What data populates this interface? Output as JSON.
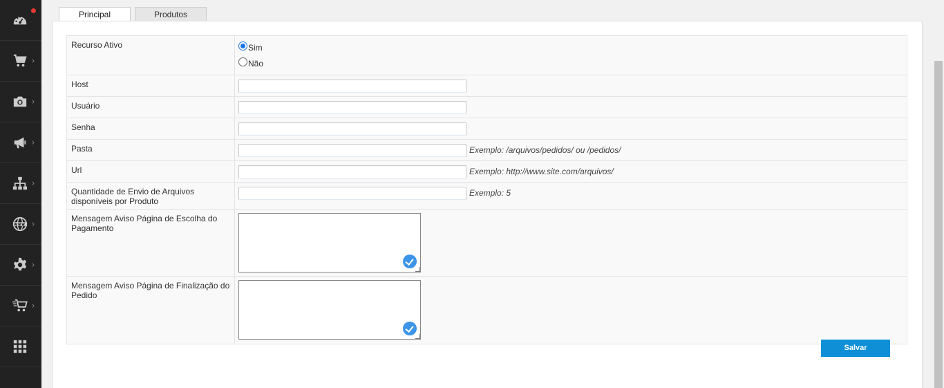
{
  "sidebar": {
    "items": [
      {
        "icon": "dashboard-icon",
        "has_chevron": false,
        "has_notification": true
      },
      {
        "icon": "cart-icon",
        "has_chevron": true
      },
      {
        "icon": "camera-icon",
        "has_chevron": true
      },
      {
        "icon": "megaphone-icon",
        "has_chevron": true
      },
      {
        "icon": "sitemap-icon",
        "has_chevron": true
      },
      {
        "icon": "globe-www-icon",
        "has_chevron": true
      },
      {
        "icon": "gear-icon",
        "has_chevron": true
      },
      {
        "icon": "fast-cart-icon",
        "has_chevron": true
      },
      {
        "icon": "apps-grid-icon",
        "has_chevron": false
      }
    ],
    "chevron": "›"
  },
  "tabs": [
    {
      "label": "Principal",
      "active": true
    },
    {
      "label": "Produtos",
      "active": false
    }
  ],
  "form": {
    "recurso_ativo": {
      "label": "Recurso Ativo",
      "options": [
        {
          "label": "Sim",
          "checked": true
        },
        {
          "label": "Não",
          "checked": false
        }
      ]
    },
    "host": {
      "label": "Host",
      "value": ""
    },
    "usuario": {
      "label": "Usuário",
      "value": ""
    },
    "senha": {
      "label": "Senha",
      "value": ""
    },
    "pasta": {
      "label": "Pasta",
      "value": "",
      "hint": "Exemplo: /arquivos/pedidos/ ou /pedidos/"
    },
    "url": {
      "label": "Url",
      "value": "",
      "hint": "Exemplo: http://www.site.com/arquivos/"
    },
    "quantidade": {
      "label": "Quantidade de Envio de Arquivos disponíveis por Produto",
      "value": "",
      "hint": "Exemplo: 5"
    },
    "msg_pagamento": {
      "label": "Mensagem Aviso Página de Escolha do Pagamento",
      "value": ""
    },
    "msg_finalizacao": {
      "label": "Mensagem Aviso Página de Finalização do Pedido",
      "value": ""
    }
  },
  "actions": {
    "save_label": "Salvar"
  },
  "colors": {
    "sidebar_bg": "#222222",
    "accent": "#0e8fd6",
    "check": "#3d95e8",
    "notification": "#e53935"
  }
}
